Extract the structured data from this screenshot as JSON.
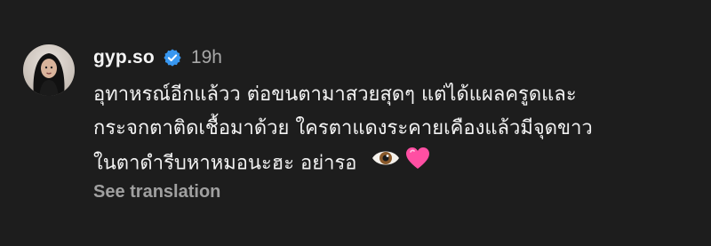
{
  "comment": {
    "username": "gyp.so",
    "verified_icon": "verified-badge-icon",
    "time": "19h",
    "text_lines": [
      "อุทาหรณ์อีกแล้วว ต่อขนตามาสวยสุดๆ แต่ได้แผลครูดและ",
      "กระจกตาติดเชื้อมาด้วย ใครตาแดงระคายเคืองแล้วมีจุดขาว",
      "ในตาดำรีบหาหมอนะฮะ อย่ารอ"
    ],
    "emojis": [
      "eye-emoji-icon",
      "pink-heart-emoji-icon"
    ],
    "see_translation": "See translation"
  },
  "colors": {
    "background": "#1d1d1d",
    "text": "#f2f2f2",
    "muted": "#a8a8a8",
    "verified_blue": "#3897f0",
    "heart_pink": "#ff4fa3"
  }
}
